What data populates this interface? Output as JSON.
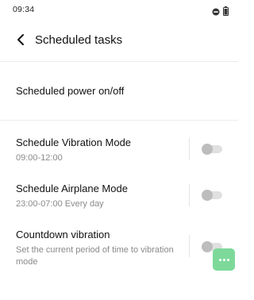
{
  "status_bar": {
    "time": "09:34",
    "icons": [
      "dnd-icon",
      "battery-icon"
    ]
  },
  "header": {
    "title": "Scheduled tasks",
    "back_icon": "chevron-left-icon"
  },
  "items": [
    {
      "title": "Scheduled power on/off"
    },
    {
      "title": "Schedule Vibration Mode",
      "subtitle": "09:00-12:00",
      "enabled": false
    },
    {
      "title": "Schedule Airplane Mode",
      "subtitle": "23:00-07:00 Every day",
      "enabled": false
    },
    {
      "title": "Countdown vibration",
      "subtitle": "Set the current period of time to vibration mode",
      "enabled": false
    }
  ],
  "floating_button": {
    "icon": "more-dots-icon",
    "color": "#7dd99a"
  }
}
